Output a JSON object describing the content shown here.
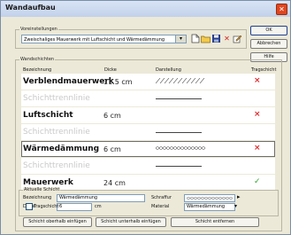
{
  "window": {
    "title": "Wandaufbau"
  },
  "buttons": {
    "ok": "OK",
    "cancel": "Abbrechen",
    "help": "Hilfe"
  },
  "presets": {
    "group_label": "Voreinstellungen",
    "selected": "Zweischaliges Mauerwerk mit Luftschicht und Wärmedämmung"
  },
  "layers_group": {
    "label": "Wandschichten"
  },
  "columns": {
    "name": "Bezeichnung",
    "thickness": "Dicke",
    "display": "Darstellung",
    "load_bearing": "Tragschicht"
  },
  "layers": [
    {
      "name": "Verblendmauerwerk",
      "thickness": "11.5 cm",
      "load_bearing": "×"
    },
    {
      "name": "Schichttrennlinie"
    },
    {
      "name": "Luftschicht",
      "thickness": "6 cm",
      "load_bearing": "×"
    },
    {
      "name": "Schichttrennlinie"
    },
    {
      "name": "Wärmedämmung",
      "thickness": "6 cm",
      "load_bearing": "×"
    },
    {
      "name": "Schichttrennlinie"
    },
    {
      "name": "Mauerwerk",
      "thickness": "24 cm",
      "load_bearing": "✓"
    }
  ],
  "current": {
    "group_label": "Aktuelle Schicht",
    "name_label": "Bezeichnung",
    "name_value": "Wärmedämmung",
    "thickness_label": "Dicke",
    "thickness_value": "6",
    "thickness_unit": "cm",
    "load_bearing_label": "Tragschicht",
    "hatch_label": "Schraffur",
    "material_label": "Material",
    "material_value": "Wärmedämmung"
  },
  "actions": {
    "insert_above": "Schicht oberhalb einfügen",
    "insert_below": "Schicht unterhalb einfügen",
    "remove": "Schicht entfernen"
  },
  "colors": {
    "cross": "#e0282a",
    "check": "#2fa42f",
    "accent": "#0a246a"
  }
}
